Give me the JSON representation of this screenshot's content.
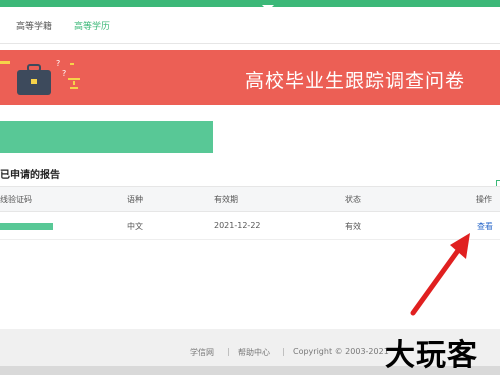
{
  "tabs": [
    {
      "label": "高等学籍"
    },
    {
      "label": "高等学历"
    }
  ],
  "banner": {
    "title": "高校毕业生跟踪调查问卷"
  },
  "section": {
    "title": "已申请的报告"
  },
  "table": {
    "headers": [
      "线验证码",
      "语种",
      "有效期",
      "状态",
      "操作"
    ],
    "rows": [
      {
        "language": "中文",
        "expiry": "2021-12-22",
        "status": "有效",
        "action": "查看"
      }
    ]
  },
  "footer": {
    "links": [
      "学信网",
      "帮助中心"
    ],
    "separator": "|",
    "copyright": "Copyright © 2003-2021"
  },
  "watermark": "大玩客",
  "colors": {
    "accent": "#3cb878",
    "banner": "#ec5f55",
    "link": "#2b6acb",
    "arrow": "#e02020"
  }
}
